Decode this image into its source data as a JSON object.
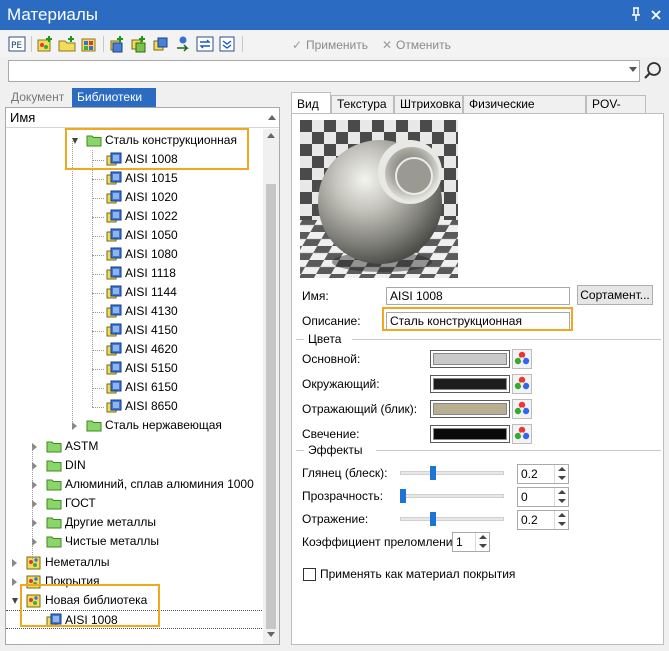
{
  "window": {
    "title": "Материалы",
    "pin_glyph": "⊥",
    "close_glyph": "✕"
  },
  "toolbar": {
    "apply_label": "Применить",
    "cancel_label": "Отменить"
  },
  "search": {
    "value": "",
    "placeholder": ""
  },
  "left_tabs": [
    {
      "label": "Документ"
    },
    {
      "label": "Библиотеки"
    }
  ],
  "tree": {
    "header": "Имя",
    "steel_group": "Сталь конструкционная",
    "steel_items": [
      "AISI 1008",
      "AISI 1015",
      "AISI 1020",
      "AISI 1022",
      "AISI 1050",
      "AISI 1080",
      "AISI 1118",
      "AISI 1144",
      "AISI 4130",
      "AISI 4150",
      "AISI 4620",
      "AISI 5150",
      "AISI 6150",
      "AISI 8650"
    ],
    "stainless": "Сталь нержавеющая",
    "metals": [
      "ASTM",
      "DIN",
      "Алюминий, сплав алюминия 1000",
      "ГОСТ",
      "Другие металлы",
      "Чистые металлы"
    ],
    "libraries": [
      "Неметаллы",
      "Покрытия",
      "Новая библиотека"
    ],
    "new_lib_item": "AISI 1008"
  },
  "right_tabs": [
    {
      "label": "Вид"
    },
    {
      "label": "Текстура"
    },
    {
      "label": "Штриховка"
    },
    {
      "label": "Физические свойства"
    },
    {
      "label": "POV-Ray"
    }
  ],
  "props": {
    "name_label": "Имя:",
    "name_value": "AISI 1008",
    "assortment_button": "Сортамент...",
    "desc_label": "Описание:",
    "desc_value": "Сталь конструкционная",
    "colors_group": "Цвета",
    "colors": [
      {
        "label": "Основной:",
        "hex": "#c9c9c9"
      },
      {
        "label": "Окружающий:",
        "hex": "#1e1e1e"
      },
      {
        "label": "Отражающий (блик):",
        "hex": "#b8ae92"
      },
      {
        "label": "Свечение:",
        "hex": "#0a0a0a"
      }
    ],
    "effects_group": "Эффекты",
    "effects": [
      {
        "label": "Глянец (блеск):",
        "value": "0.2",
        "level": 0.2
      },
      {
        "label": "Прозрачность:",
        "value": "0",
        "level": 0.0
      },
      {
        "label": "Отражение:",
        "value": "0.2",
        "level": 0.2
      }
    ],
    "refraction_label": "Коэффициент преломления:",
    "refraction_value": "1",
    "coating_checkbox_label": "Применять как материал покрытия",
    "coating_checked": false
  },
  "highlight_color": "#f0a81e",
  "accent_color": "#2b6cc2"
}
